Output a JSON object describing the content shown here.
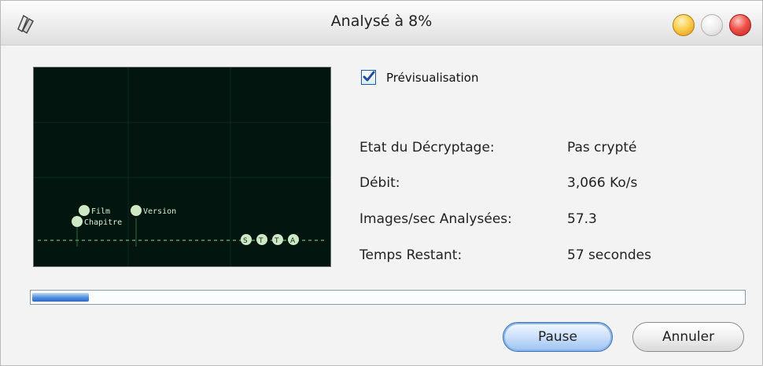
{
  "window": {
    "title": "Analysé à 8%"
  },
  "preview": {
    "checkbox_label": "Prévisualisation",
    "checked": true,
    "frame_text": [
      "Film",
      "Version",
      "Chapitre",
      "S",
      "T",
      "T",
      "A"
    ]
  },
  "info": {
    "decryption_label": "Etat du Décryptage:",
    "decryption_value": "Pas crypté",
    "bitrate_label": "Débit:",
    "bitrate_value": "3,066 Ko/s",
    "fps_label": "Images/sec Analysées:",
    "fps_value": "57.3",
    "remaining_label": "Temps Restant:",
    "remaining_value": "57 secondes"
  },
  "progress": {
    "percent": 8
  },
  "buttons": {
    "pause": "Pause",
    "cancel": "Annuler"
  },
  "colors": {
    "accent": "#2f6bc4",
    "preview_bg": "#02160f"
  }
}
